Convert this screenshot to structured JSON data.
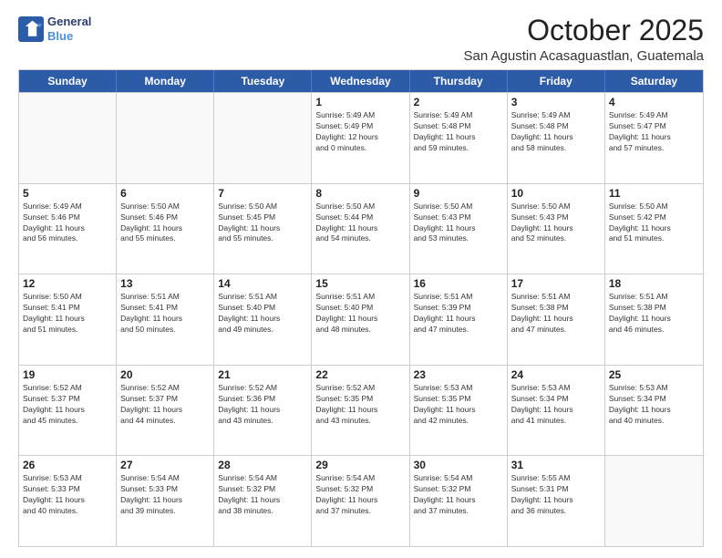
{
  "logo": {
    "line1": "General",
    "line2": "Blue"
  },
  "title": "October 2025",
  "location": "San Agustin Acasaguastlan, Guatemala",
  "days_of_week": [
    "Sunday",
    "Monday",
    "Tuesday",
    "Wednesday",
    "Thursday",
    "Friday",
    "Saturday"
  ],
  "weeks": [
    [
      {
        "day": "",
        "text": ""
      },
      {
        "day": "",
        "text": ""
      },
      {
        "day": "",
        "text": ""
      },
      {
        "day": "1",
        "text": "Sunrise: 5:49 AM\nSunset: 5:49 PM\nDaylight: 12 hours\nand 0 minutes."
      },
      {
        "day": "2",
        "text": "Sunrise: 5:49 AM\nSunset: 5:48 PM\nDaylight: 11 hours\nand 59 minutes."
      },
      {
        "day": "3",
        "text": "Sunrise: 5:49 AM\nSunset: 5:48 PM\nDaylight: 11 hours\nand 58 minutes."
      },
      {
        "day": "4",
        "text": "Sunrise: 5:49 AM\nSunset: 5:47 PM\nDaylight: 11 hours\nand 57 minutes."
      }
    ],
    [
      {
        "day": "5",
        "text": "Sunrise: 5:49 AM\nSunset: 5:46 PM\nDaylight: 11 hours\nand 56 minutes."
      },
      {
        "day": "6",
        "text": "Sunrise: 5:50 AM\nSunset: 5:46 PM\nDaylight: 11 hours\nand 55 minutes."
      },
      {
        "day": "7",
        "text": "Sunrise: 5:50 AM\nSunset: 5:45 PM\nDaylight: 11 hours\nand 55 minutes."
      },
      {
        "day": "8",
        "text": "Sunrise: 5:50 AM\nSunset: 5:44 PM\nDaylight: 11 hours\nand 54 minutes."
      },
      {
        "day": "9",
        "text": "Sunrise: 5:50 AM\nSunset: 5:43 PM\nDaylight: 11 hours\nand 53 minutes."
      },
      {
        "day": "10",
        "text": "Sunrise: 5:50 AM\nSunset: 5:43 PM\nDaylight: 11 hours\nand 52 minutes."
      },
      {
        "day": "11",
        "text": "Sunrise: 5:50 AM\nSunset: 5:42 PM\nDaylight: 11 hours\nand 51 minutes."
      }
    ],
    [
      {
        "day": "12",
        "text": "Sunrise: 5:50 AM\nSunset: 5:41 PM\nDaylight: 11 hours\nand 51 minutes."
      },
      {
        "day": "13",
        "text": "Sunrise: 5:51 AM\nSunset: 5:41 PM\nDaylight: 11 hours\nand 50 minutes."
      },
      {
        "day": "14",
        "text": "Sunrise: 5:51 AM\nSunset: 5:40 PM\nDaylight: 11 hours\nand 49 minutes."
      },
      {
        "day": "15",
        "text": "Sunrise: 5:51 AM\nSunset: 5:40 PM\nDaylight: 11 hours\nand 48 minutes."
      },
      {
        "day": "16",
        "text": "Sunrise: 5:51 AM\nSunset: 5:39 PM\nDaylight: 11 hours\nand 47 minutes."
      },
      {
        "day": "17",
        "text": "Sunrise: 5:51 AM\nSunset: 5:38 PM\nDaylight: 11 hours\nand 47 minutes."
      },
      {
        "day": "18",
        "text": "Sunrise: 5:51 AM\nSunset: 5:38 PM\nDaylight: 11 hours\nand 46 minutes."
      }
    ],
    [
      {
        "day": "19",
        "text": "Sunrise: 5:52 AM\nSunset: 5:37 PM\nDaylight: 11 hours\nand 45 minutes."
      },
      {
        "day": "20",
        "text": "Sunrise: 5:52 AM\nSunset: 5:37 PM\nDaylight: 11 hours\nand 44 minutes."
      },
      {
        "day": "21",
        "text": "Sunrise: 5:52 AM\nSunset: 5:36 PM\nDaylight: 11 hours\nand 43 minutes."
      },
      {
        "day": "22",
        "text": "Sunrise: 5:52 AM\nSunset: 5:35 PM\nDaylight: 11 hours\nand 43 minutes."
      },
      {
        "day": "23",
        "text": "Sunrise: 5:53 AM\nSunset: 5:35 PM\nDaylight: 11 hours\nand 42 minutes."
      },
      {
        "day": "24",
        "text": "Sunrise: 5:53 AM\nSunset: 5:34 PM\nDaylight: 11 hours\nand 41 minutes."
      },
      {
        "day": "25",
        "text": "Sunrise: 5:53 AM\nSunset: 5:34 PM\nDaylight: 11 hours\nand 40 minutes."
      }
    ],
    [
      {
        "day": "26",
        "text": "Sunrise: 5:53 AM\nSunset: 5:33 PM\nDaylight: 11 hours\nand 40 minutes."
      },
      {
        "day": "27",
        "text": "Sunrise: 5:54 AM\nSunset: 5:33 PM\nDaylight: 11 hours\nand 39 minutes."
      },
      {
        "day": "28",
        "text": "Sunrise: 5:54 AM\nSunset: 5:32 PM\nDaylight: 11 hours\nand 38 minutes."
      },
      {
        "day": "29",
        "text": "Sunrise: 5:54 AM\nSunset: 5:32 PM\nDaylight: 11 hours\nand 37 minutes."
      },
      {
        "day": "30",
        "text": "Sunrise: 5:54 AM\nSunset: 5:32 PM\nDaylight: 11 hours\nand 37 minutes."
      },
      {
        "day": "31",
        "text": "Sunrise: 5:55 AM\nSunset: 5:31 PM\nDaylight: 11 hours\nand 36 minutes."
      },
      {
        "day": "",
        "text": ""
      }
    ]
  ]
}
